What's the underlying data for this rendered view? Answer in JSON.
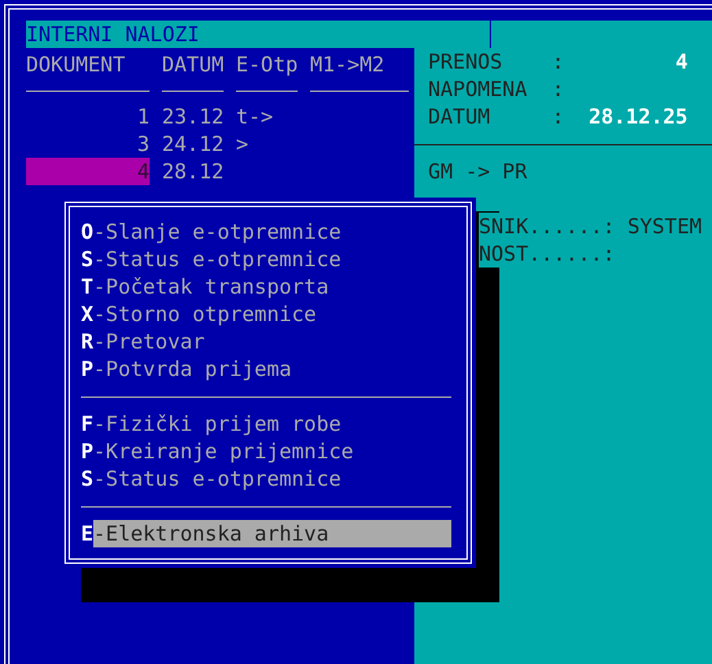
{
  "title_bar": {
    "title": "INTERNI NALOZI"
  },
  "columns": [
    "DOKUMENT",
    "DATUM",
    "E-Otp",
    "M1->M2"
  ],
  "rows": [
    {
      "dokument": "1",
      "datum": "23.12",
      "e_otp": "t->",
      "selected": false
    },
    {
      "dokument": "3",
      "datum": "24.12",
      "e_otp": ">",
      "selected": false
    },
    {
      "dokument": "4",
      "datum": "28.12",
      "selected": true
    }
  ],
  "info": {
    "fields": [
      {
        "label": "PRENOS    :",
        "value": "4"
      },
      {
        "label": "NAPOMENA  :"
      },
      {
        "label": "DATUM     :",
        "value": "28.12.25"
      }
    ],
    "route": "GM -> PR",
    "partial_fields": [
      {
        "label": "SNIK......:",
        "value": "SYSTEM"
      },
      {
        "label": "NOST......:"
      }
    ]
  },
  "menu": {
    "groups": [
      [
        {
          "key": "O",
          "label": "-Slanje e-otpremnice",
          "selected": false
        },
        {
          "key": "S",
          "label": "-Status e-otpremnice",
          "selected": false
        },
        {
          "key": "T",
          "label": "-Početak transporta",
          "selected": false
        },
        {
          "key": "X",
          "label": "-Storno otpremnice",
          "selected": false
        },
        {
          "key": "R",
          "label": "-Pretovar",
          "selected": false
        },
        {
          "key": "P",
          "label": "-Potvrda prijema",
          "selected": false
        }
      ],
      [
        {
          "key": "F",
          "label": "-Fizički prijem robe",
          "selected": false
        },
        {
          "key": "P",
          "label": "-Kreiranje prijemnice",
          "selected": false
        },
        {
          "key": "S",
          "label": "-Status e-otpremnice",
          "selected": false
        }
      ],
      [
        {
          "key": "E",
          "label": "-Elektronska arhiva",
          "selected": true
        }
      ]
    ]
  }
}
